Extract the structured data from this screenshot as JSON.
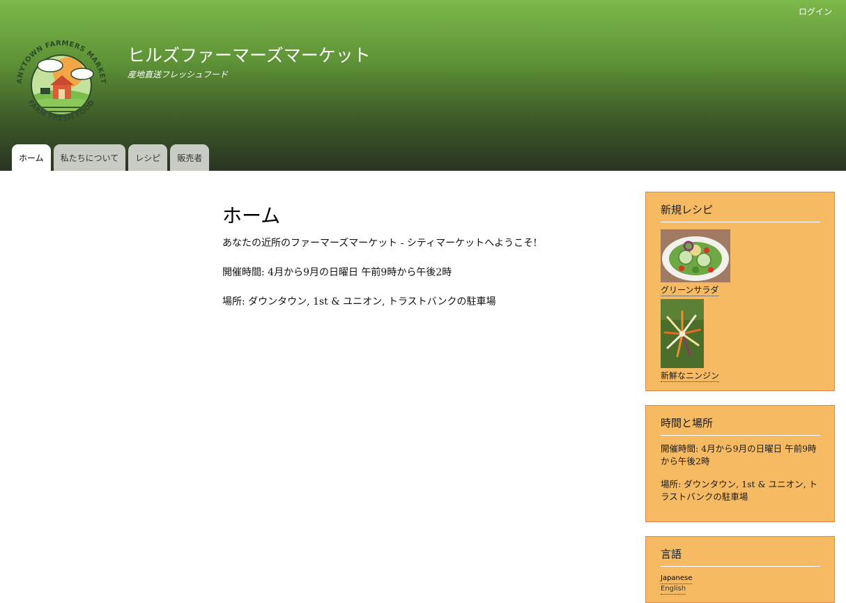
{
  "header": {
    "login": "ログイン",
    "site_name": "ヒルズファーマーズマーケット",
    "slogan": "産地直送フレッシュフード",
    "logo": {
      "ring_text_top": "ANYTOWN FARMERS MARKET",
      "ring_text_bottom": "FARM FRESH FOOD"
    },
    "tabs": [
      {
        "label": "ホーム",
        "active": true
      },
      {
        "label": "私たちについて",
        "active": false
      },
      {
        "label": "レシピ",
        "active": false
      },
      {
        "label": "販売者",
        "active": false
      }
    ]
  },
  "main": {
    "title": "ホーム",
    "paragraphs": [
      "あなたの近所のファーマーズマーケット - シティマーケットへようこそ!",
      "開催時間: 4月から9月の日曜日 午前9時から午後2時",
      "場所: ダウンタウン, 1st & ユニオン, トラストバンクの駐車場"
    ]
  },
  "sidebar": {
    "recipes": {
      "title": "新規レシピ",
      "items": [
        {
          "caption": "グリーンサラダ",
          "image": "salad-photo"
        },
        {
          "caption": "新鮮なニンジン",
          "image": "carrots-photo"
        }
      ]
    },
    "hours": {
      "title": "時間と場所",
      "paragraphs": [
        "開催時間: 4月から9月の日曜日 午前9時から午後2時",
        "場所: ダウンタウン, 1st & ユニオン, トラストバンクの駐車場"
      ]
    },
    "language": {
      "title": "言語",
      "items": [
        {
          "label": "Japanese",
          "active": true
        },
        {
          "label": "English",
          "active": false
        }
      ]
    }
  },
  "colors": {
    "header_top": "#7db84a",
    "header_bottom": "#2a3423",
    "tab_inactive": "#c9cbc5",
    "sidebar_bg": "#f6bb62",
    "sidebar_border": "#e0874f"
  }
}
